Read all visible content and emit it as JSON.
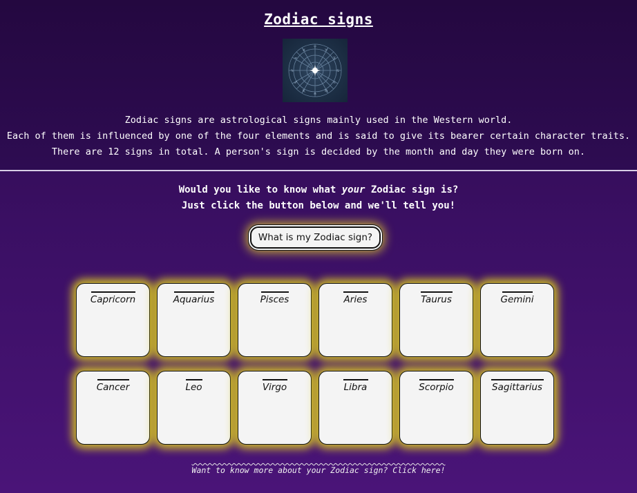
{
  "header": {
    "title": "Zodiac signs",
    "logo_icon": "zodiac-wheel-icon",
    "intro_lines": [
      "Zodiac signs are astrological signs mainly used in the Western world.",
      "Each of them is influenced by one of the four elements and is said to give its bearer certain character traits.",
      "There are 12 signs in total. A person's sign is decided by the month and day they were born on."
    ]
  },
  "prompt": {
    "line1_before": "Would you like to know what ",
    "line1_emphasis": "your",
    "line1_after": " Zodiac sign is?",
    "line2": "Just click the button below and we'll tell you!"
  },
  "button_label": "What is my Zodiac sign?",
  "signs": [
    "Capricorn",
    "Aquarius",
    "Pisces",
    "Aries",
    "Taurus",
    "Gemini",
    "Cancer",
    "Leo",
    "Virgo",
    "Libra",
    "Scorpio",
    "Sagittarius"
  ],
  "footer_link": "Want to know more about your Zodiac sign? Click here!",
  "colors": {
    "background_top": "#2a0a45",
    "background_bottom": "#4a1478",
    "glow": "#e2d21e",
    "card": "#f4f4f4"
  }
}
